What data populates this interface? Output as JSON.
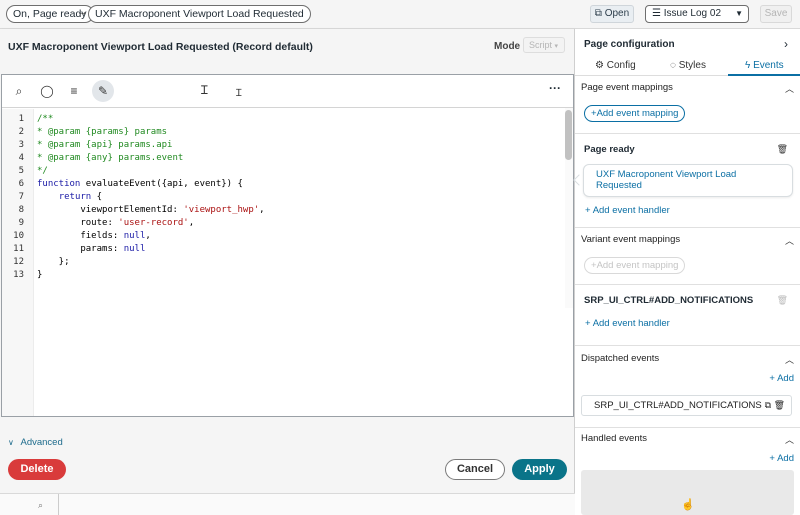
{
  "topbar": {
    "crumb1": "On, Page ready",
    "crumb_arrow": "→",
    "crumb2": "UXF Macroponent Viewport Load Requested",
    "open_label": "Open",
    "issue_select": "Issue Log 02",
    "save_label": "Save"
  },
  "modal": {
    "title": "UXF Macroponent Viewport Load Requested (Record default)",
    "mode_label": "Mode",
    "mode_value": "Script",
    "advanced_label": "Advanced",
    "delete_label": "Delete",
    "cancel_label": "Cancel",
    "apply_label": "Apply"
  },
  "editor": {
    "toolbar_icons": [
      "search-icon",
      "comment-icon",
      "format-icon",
      "script-icon",
      "more-icon"
    ],
    "line_numbers": [
      "1",
      "2",
      "3",
      "4",
      "5",
      "6",
      "7",
      "8",
      "9",
      "10",
      "11",
      "12",
      "13"
    ],
    "lines": [
      "/**",
      "* @param {params} params",
      "* @param {api} params.api",
      "* @param {any} params.event",
      "*/",
      "function evaluateEvent({api, event}) {",
      "    return {",
      "        viewportElementId: 'viewport_hwp',",
      "        route: 'user-record',",
      "        fields: null,",
      "        params: null",
      "    };",
      "}"
    ]
  },
  "right_panel": {
    "title": "Page configuration",
    "tabs": [
      {
        "label": "Config",
        "icon": "gear-icon"
      },
      {
        "label": "Styles",
        "icon": "palette-icon"
      },
      {
        "label": "Events",
        "icon": "lightning-icon",
        "active": true
      }
    ],
    "page_event_mappings": {
      "title": "Page event mappings",
      "add_label": "Add event mapping"
    },
    "page_ready": {
      "title": "Page ready",
      "card_text": "UXF Macroponent Viewport Load Requested",
      "add_handler_label": "Add event handler"
    },
    "variant_event_mappings": {
      "title": "Variant event mappings",
      "add_label": "Add event mapping"
    },
    "srp": {
      "title": "SRP_UI_CTRL#ADD_NOTIFICATIONS",
      "add_handler_label": "Add event handler"
    },
    "dispatched_events": {
      "title": "Dispatched events",
      "add_label": "Add",
      "item": "SRP_UI_CTRL#ADD_NOTIFICATIONS"
    },
    "handled_events": {
      "title": "Handled events",
      "add_label": "Add"
    }
  },
  "colors": {
    "accent": "#0b6fa4",
    "apply": "#0a7489",
    "delete": "#d93b3b"
  }
}
